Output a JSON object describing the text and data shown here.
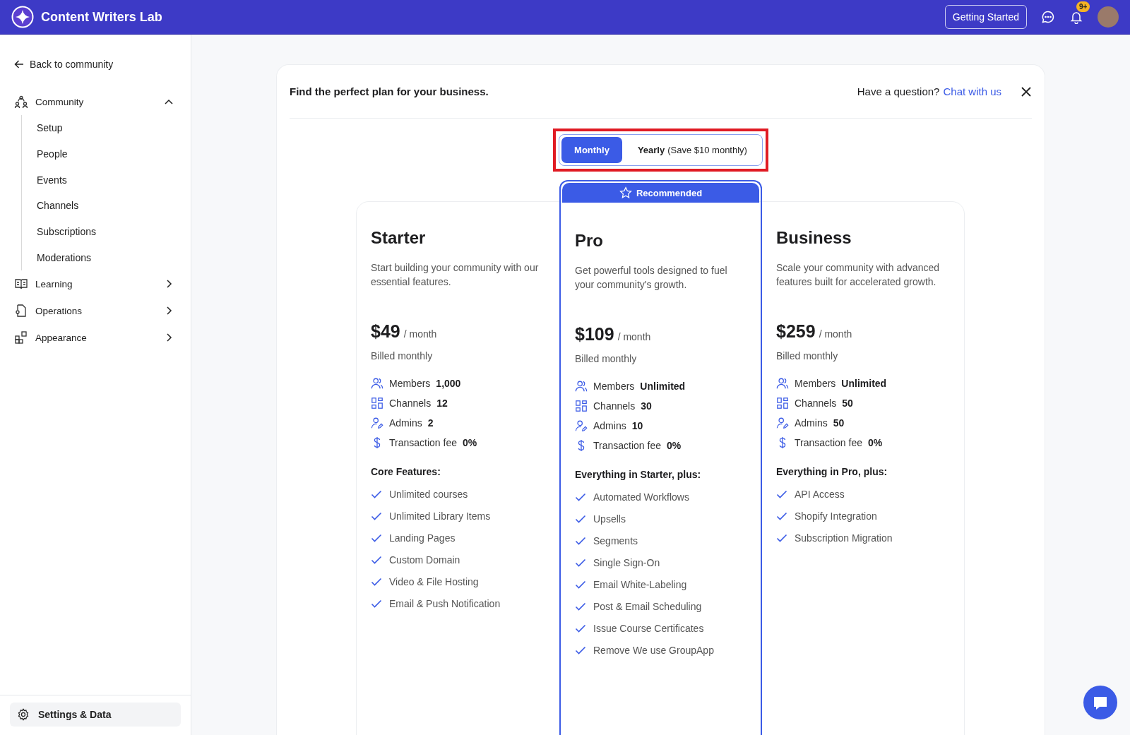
{
  "topbar": {
    "brand": "Content Writers Lab",
    "button": "Getting Started",
    "notification_badge": "9+"
  },
  "sidebar": {
    "back_link": "Back to community",
    "items": [
      {
        "label": "Community",
        "kind": "community",
        "expanded": true,
        "children": [
          {
            "label": "Setup"
          },
          {
            "label": "People"
          },
          {
            "label": "Events"
          },
          {
            "label": "Channels"
          },
          {
            "label": "Subscriptions"
          },
          {
            "label": "Moderations"
          }
        ]
      },
      {
        "label": "Learning",
        "kind": "learning",
        "expanded": false
      },
      {
        "label": "Operations",
        "kind": "operations",
        "expanded": false
      },
      {
        "label": "Appearance",
        "kind": "appearance",
        "expanded": false
      }
    ],
    "footer": "Settings & Data"
  },
  "pricing": {
    "heading": "Find the perfect plan for your business.",
    "question": "Have a question?",
    "chat_link": "Chat with us",
    "billing_options": [
      {
        "label": "Monthly",
        "selected": true
      },
      {
        "label": "Yearly",
        "note": "(Save $10 monthly)",
        "selected": false
      }
    ],
    "plans": [
      {
        "name": "Starter",
        "description": "Start building your community with our essential features.",
        "price": "$49",
        "period": "/ month",
        "billing": "Billed monthly",
        "recommended": false,
        "limits": [
          {
            "kind": "members",
            "label": "Members",
            "value": "1,000"
          },
          {
            "kind": "channels",
            "label": "Channels",
            "value": "12"
          },
          {
            "kind": "admins",
            "label": "Admins",
            "value": "2"
          },
          {
            "kind": "fee",
            "label": "Transaction fee",
            "value": "0%"
          }
        ],
        "features_title": "Core Features:",
        "features": [
          "Unlimited courses",
          "Unlimited Library Items",
          "Landing Pages",
          "Custom Domain",
          "Video & File Hosting",
          "Email & Push Notification"
        ]
      },
      {
        "name": "Pro",
        "description": "Get powerful tools designed to fuel your community's growth.",
        "price": "$109",
        "period": "/ month",
        "billing": "Billed monthly",
        "recommended": true,
        "recommended_label": "Recommended",
        "limits": [
          {
            "kind": "members",
            "label": "Members",
            "value": "Unlimited"
          },
          {
            "kind": "channels",
            "label": "Channels",
            "value": "30"
          },
          {
            "kind": "admins",
            "label": "Admins",
            "value": "10"
          },
          {
            "kind": "fee",
            "label": "Transaction fee",
            "value": "0%"
          }
        ],
        "features_title": "Everything in Starter, plus:",
        "features": [
          "Automated Workflows",
          "Upsells",
          "Segments",
          "Single Sign-On",
          "Email White-Labeling",
          "Post & Email Scheduling",
          "Issue Course Certificates",
          "Remove We use GroupApp"
        ]
      },
      {
        "name": "Business",
        "description": "Scale your community with advanced features built for accelerated growth.",
        "price": "$259",
        "period": "/ month",
        "billing": "Billed monthly",
        "recommended": false,
        "limits": [
          {
            "kind": "members",
            "label": "Members",
            "value": "Unlimited"
          },
          {
            "kind": "channels",
            "label": "Channels",
            "value": "50"
          },
          {
            "kind": "admins",
            "label": "Admins",
            "value": "50"
          },
          {
            "kind": "fee",
            "label": "Transaction fee",
            "value": "0%"
          }
        ],
        "features_title": "Everything in Pro, plus:",
        "features": [
          "API Access",
          "Shopify Integration",
          "Subscription Migration"
        ]
      }
    ]
  }
}
